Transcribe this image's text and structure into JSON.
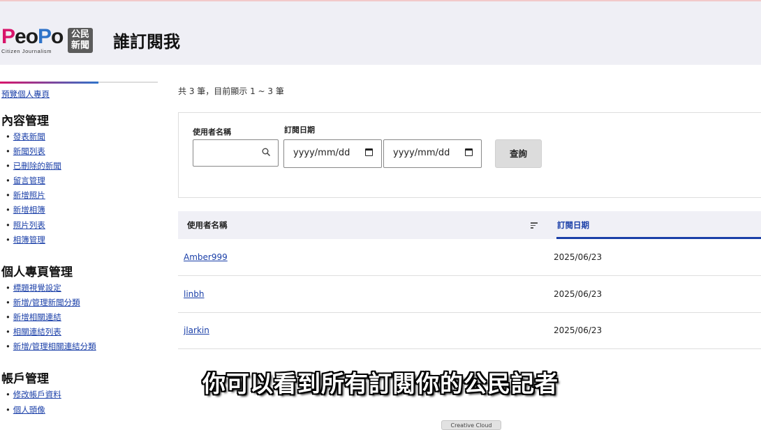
{
  "header": {
    "logo": {
      "word_p1": "P",
      "word_eo": "eo",
      "word_p2": "P",
      "word_o2": "o",
      "tagline": "Citizen Journalism",
      "badge_line1": "公民",
      "badge_line2": "新聞"
    },
    "title": "誰訂閱我"
  },
  "sidebar": {
    "preview_link": "預覽個人專頁",
    "sections": [
      {
        "heading": "內容管理",
        "items": [
          "發表新聞",
          "新聞列表",
          "已刪除的新聞",
          "留言管理",
          "新增照片",
          "新增相簿",
          "照片列表",
          "相簿管理"
        ]
      },
      {
        "heading": "個人專頁管理",
        "items": [
          "標題視覺設定",
          "新增/管理新聞分類",
          "新增相關連結",
          "相關連結列表",
          "新增/管理相關連結分類"
        ]
      },
      {
        "heading": "帳戶管理",
        "items": [
          "修改帳戶資料",
          "個人頭像"
        ]
      }
    ],
    "bullet": "•"
  },
  "results": {
    "count_text": "共 3 筆，目前顯示 1 ~ 3 筆"
  },
  "filter": {
    "username_label": "使用者名稱",
    "username_value": "",
    "date_label": "訂閱日期",
    "date_from_placeholder": "yyyy/mm/dd",
    "date_to_placeholder": "yyyy/mm/dd",
    "query_button": "查詢"
  },
  "table": {
    "columns": [
      "使用者名稱",
      "訂閱日期"
    ],
    "active_sort_column": "訂閱日期",
    "rows": [
      {
        "username": "Amber999",
        "date": "2025/06/23"
      },
      {
        "username": "linbh",
        "date": "2025/06/23"
      },
      {
        "username": "jlarkin",
        "date": "2025/06/23"
      }
    ]
  },
  "overlay": {
    "subtitle": "你可以看到所有訂閱你的公民記者",
    "taskbar_tab": "Creative Cloud"
  },
  "colors": {
    "accent": "#1a3fa8",
    "brand_pink": "#d8156b",
    "brand_blue": "#2f73c9",
    "header_bg": "#efeff5"
  }
}
